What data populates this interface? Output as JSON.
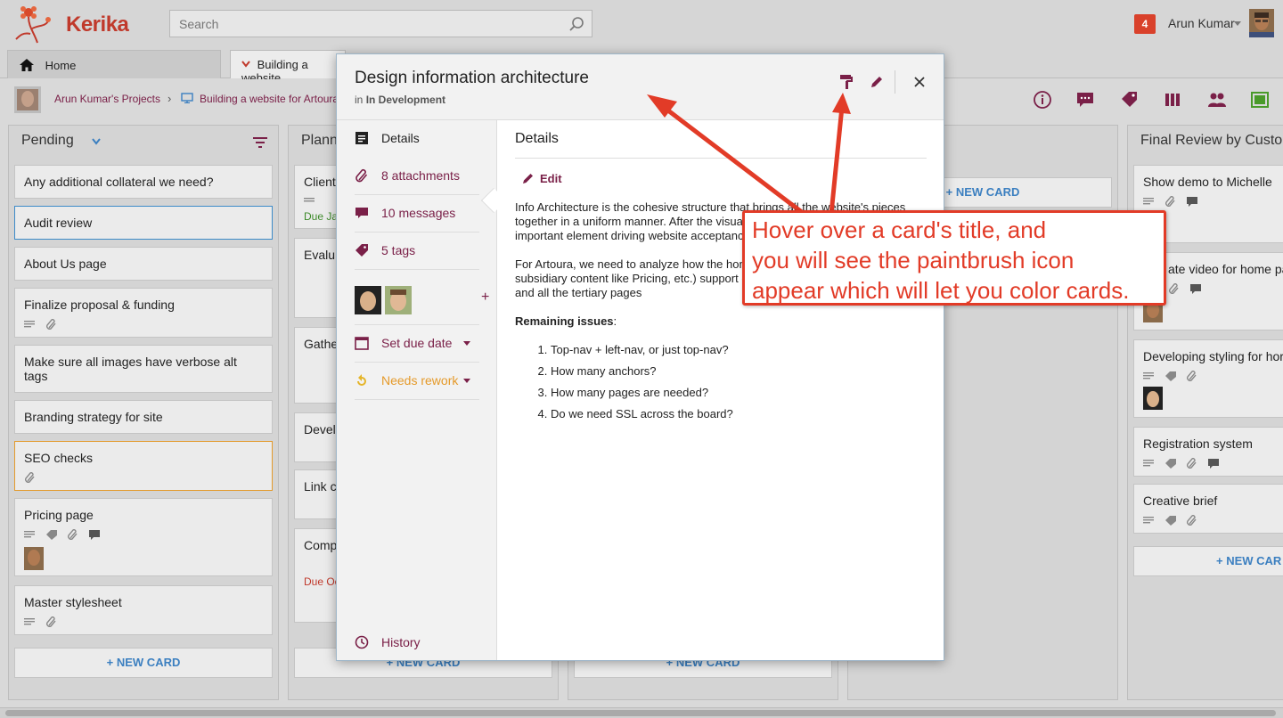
{
  "app": {
    "brand": "Kerika",
    "search_placeholder": "Search",
    "notifications": "4",
    "user_name": "Arun Kumar"
  },
  "tabs": [
    {
      "label": "Home"
    },
    {
      "label": "Building a website"
    }
  ],
  "breadcrumb": {
    "projects": "Arun Kumar's Projects",
    "separator": "›",
    "board": "Building a website for Artoura"
  },
  "columns": {
    "pending": {
      "title": "Pending",
      "cards": [
        "Any additional collateral we need?",
        "Audit review",
        "About Us page",
        "Finalize proposal & funding",
        "Make sure all images have verbose alt tags",
        "Branding strategy for site",
        "SEO checks",
        "Pricing page",
        "Master stylesheet"
      ],
      "new_card": "NEW CARD"
    },
    "planning": {
      "title": "Planni",
      "cards": [
        "Client",
        "Evalu",
        "Gathe",
        "Devel",
        "Link c",
        "Comp"
      ],
      "due1": "Due Ja",
      "due2": "Due Oc",
      "new_card": "NEW CARD"
    },
    "middle": {
      "new_card": "NEW CARD",
      "new_card_top": "NEW CARD"
    },
    "final": {
      "title": "Final Review by Custo",
      "cards": [
        "Show demo to Michelle",
        "ate video for home pa",
        "Developing styling for hor",
        "Registration system",
        "Creative brief"
      ],
      "new_card": "NEW CAR"
    }
  },
  "modal": {
    "title": "Design information architecture",
    "sub_prefix": "in",
    "sub_column": "In Development",
    "sidebar": {
      "details": "Details",
      "attachments": "8 attachments",
      "messages": "10 messages",
      "tags": "5 tags",
      "add": "+",
      "due": "Set due date",
      "status": "Needs rework",
      "history": "History"
    },
    "content": {
      "heading": "Details",
      "edit": "Edit",
      "para1": "Info Architecture is the cohesive structure that brings all the website's pieces together in a uniform manner. After the visual design, this is the single most important element driving website acceptance by users.",
      "para2": "For Artoura, we need to analyze how the homepage, the main pages and subsidiary content like Pricing, etc.) support each other, and the home page and all the tertiary pages",
      "issues_label": "Remaining issues",
      "issues_colon": ":",
      "issues": [
        "Top-nav + left-nav, or just top-nav?",
        "How many anchors?",
        "How many pages are needed?",
        "Do we need SSL across the board?"
      ]
    }
  },
  "annotation": {
    "line1": "Hover over a card's title, and",
    "line2": "you will see the paintbrush icon",
    "line3": "appear which will let you color cards."
  },
  "colors": {
    "brand_red": "#c0392b",
    "accent_plum": "#7a2048",
    "link_blue": "#3b7fc0",
    "callout_red": "#e23b27",
    "status_orange": "#e59a2a"
  },
  "icons": [
    "search-icon",
    "home-icon",
    "info-icon",
    "chat-icon",
    "tag-icon",
    "columns-icon",
    "team-icon",
    "fullscreen-icon",
    "paintbrush-icon",
    "pencil-icon",
    "close-icon",
    "calendar-icon",
    "history-icon",
    "paperclip-icon"
  ]
}
